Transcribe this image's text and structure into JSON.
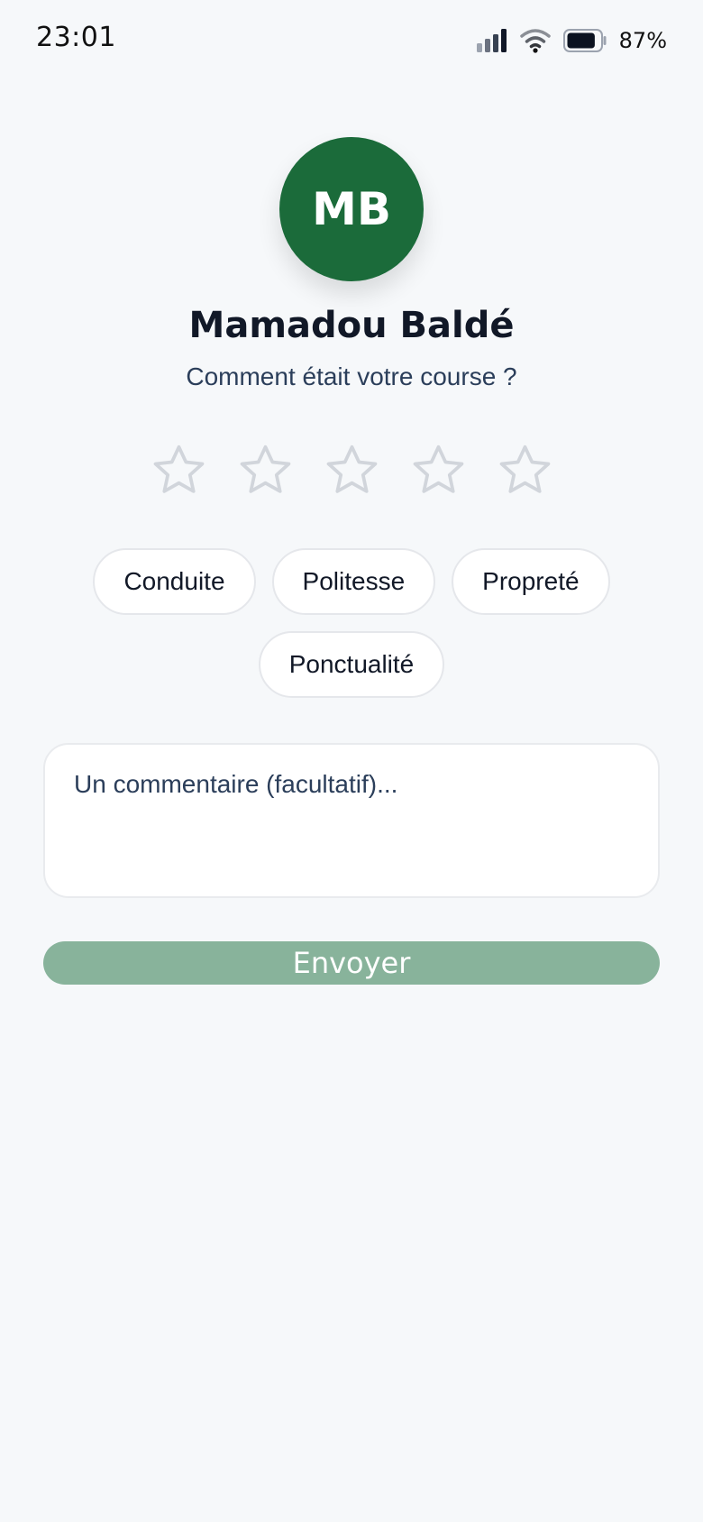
{
  "status_bar": {
    "time": "23:01",
    "battery_percent": "87%",
    "battery_level": 0.87,
    "signal_icon": "cellular-signal-icon",
    "wifi_icon": "wifi-icon",
    "battery_icon": "battery-icon"
  },
  "driver": {
    "initials": "MB",
    "name": "Mamadou Baldé"
  },
  "rating": {
    "prompt": "Comment était votre course ?",
    "max_stars": 5,
    "selected": 0,
    "star_icon": "star-outline-icon"
  },
  "tags": [
    {
      "label": "Conduite"
    },
    {
      "label": "Politesse"
    },
    {
      "label": "Propreté"
    },
    {
      "label": "Ponctualité"
    }
  ],
  "comment": {
    "value": "",
    "placeholder": "Un commentaire (facultatif)..."
  },
  "submit": {
    "label": "Envoyer"
  },
  "colors": {
    "background": "#f6f8fa",
    "avatar": "#1b6b3a",
    "submit_disabled": "#88b39b",
    "star_outline": "#d1d5db",
    "text_primary": "#111827",
    "text_secondary": "#2b3e5a"
  }
}
